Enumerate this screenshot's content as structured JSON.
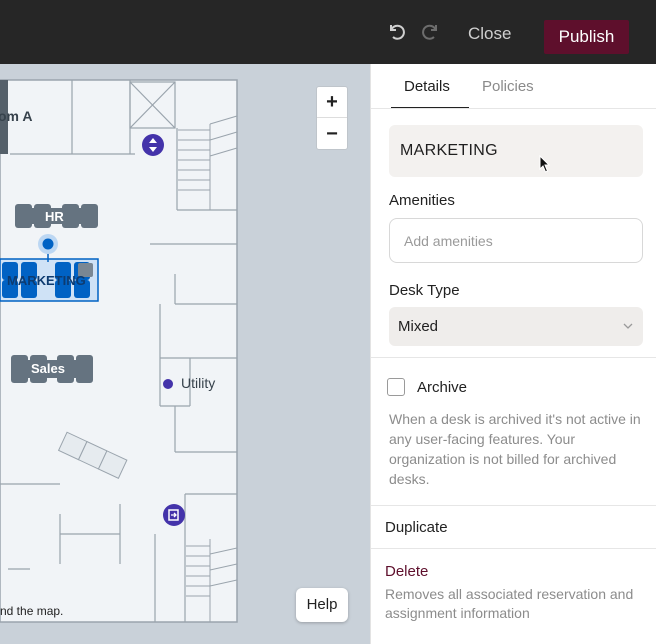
{
  "toolbar": {
    "undo_icon": "undo-icon",
    "redo_icon": "redo-icon",
    "close_label": "Close",
    "publish_label": "Publish",
    "publish_color": "#5e0f2c"
  },
  "map": {
    "rooms": {
      "room_a": "om A",
      "hr": "HR",
      "marketing": "MARKETING",
      "sales": "Sales",
      "utility": "Utility"
    },
    "zoom_in_label": "+",
    "zoom_out_label": "−",
    "help_label": "Help",
    "caption": "nd the map.",
    "accent_color": "#0062c4",
    "marker_color": "#4433aa"
  },
  "panel": {
    "tabs": [
      {
        "label": "Details",
        "active": true
      },
      {
        "label": "Policies",
        "active": false
      }
    ],
    "desk_name": "MARKETING",
    "amenities": {
      "label": "Amenities",
      "placeholder": "Add amenities",
      "value": ""
    },
    "desk_type": {
      "label": "Desk Type",
      "selected": "Mixed"
    },
    "archive": {
      "label": "Archive",
      "checked": false,
      "help": "When a desk is archived it's not active in any user-facing features. Your organization is not billed for archived desks."
    },
    "duplicate_label": "Duplicate",
    "delete": {
      "label": "Delete",
      "help": "Removes all associated reservation and assignment information"
    }
  }
}
